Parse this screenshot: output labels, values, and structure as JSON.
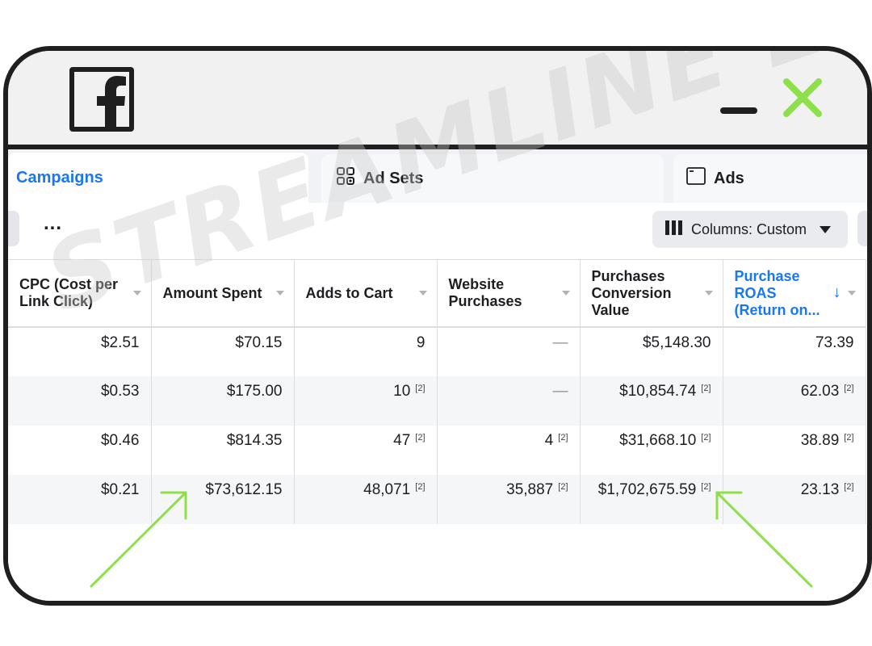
{
  "tabs": [
    {
      "label": "Campaigns",
      "icon": "campaigns"
    },
    {
      "label": "Ad Sets",
      "icon": "grid-icon"
    },
    {
      "label": "Ads",
      "icon": "window-icon"
    }
  ],
  "toolbar": {
    "more_label": "...",
    "columns_label": "Columns: Custom"
  },
  "table": {
    "headers": [
      "CPC (Cost per Link Click)",
      "Amount Spent",
      "Adds to Cart",
      "Website Purchases",
      "Purchases Conversion Value",
      "Purchase ROAS (Return on..."
    ],
    "rows": [
      [
        {
          "v": "$2.51",
          "n": ""
        },
        {
          "v": "$70.15",
          "n": ""
        },
        {
          "v": "9",
          "n": ""
        },
        {
          "v": "—",
          "n": ""
        },
        {
          "v": "$5,148.30",
          "n": ""
        },
        {
          "v": "73.39",
          "n": ""
        }
      ],
      [
        {
          "v": "$0.53",
          "n": ""
        },
        {
          "v": "$175.00",
          "n": ""
        },
        {
          "v": "10",
          "n": "[2]"
        },
        {
          "v": "—",
          "n": ""
        },
        {
          "v": "$10,854.74",
          "n": "[2]"
        },
        {
          "v": "62.03",
          "n": "[2]"
        }
      ],
      [
        {
          "v": "$0.46",
          "n": ""
        },
        {
          "v": "$814.35",
          "n": ""
        },
        {
          "v": "47",
          "n": "[2]"
        },
        {
          "v": "4",
          "n": "[2]"
        },
        {
          "v": "$31,668.10",
          "n": "[2]"
        },
        {
          "v": "38.89",
          "n": "[2]"
        }
      ],
      [
        {
          "v": "$0.21",
          "n": ""
        },
        {
          "v": "$73,612.15",
          "n": ""
        },
        {
          "v": "48,071",
          "n": "[2]"
        },
        {
          "v": "35,887",
          "n": "[2]"
        },
        {
          "v": "$1,702,675.59",
          "n": "[2]"
        },
        {
          "v": "23.13",
          "n": "[2]"
        }
      ]
    ]
  },
  "watermark": "STREAMLINE ECOM",
  "colors": {
    "accent": "#1877f2",
    "annotation_arrow": "#8ee04a",
    "close_icon": "#8ee04a",
    "frame": "#1f1f1f"
  }
}
